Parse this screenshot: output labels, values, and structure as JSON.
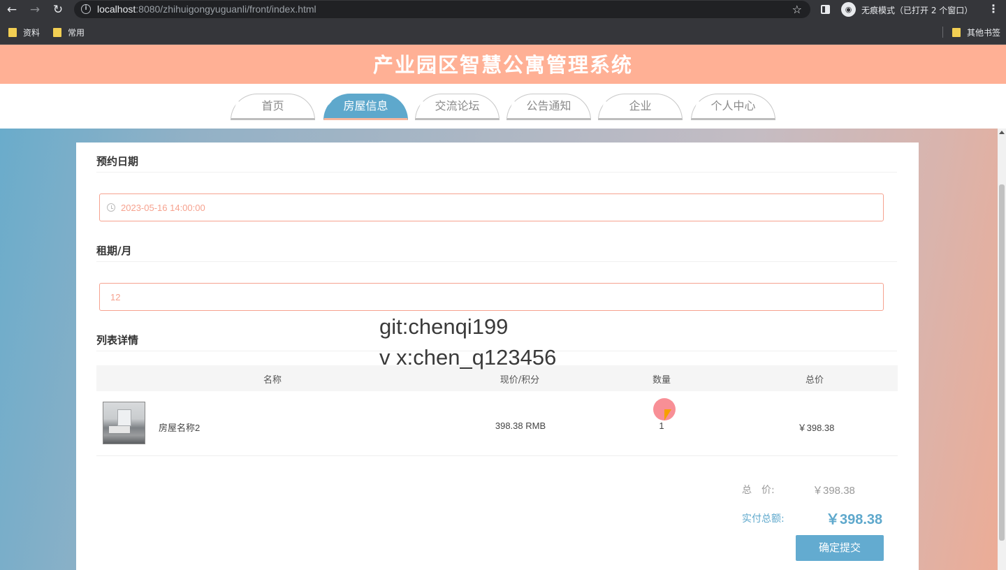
{
  "browser": {
    "url_host": "localhost",
    "url_rest": ":8080/zhihuigongyuguanli/front/index.html",
    "incognito_label": "无痕模式（已打开 2 个窗口）",
    "bookmarks": [
      "资料",
      "常用"
    ],
    "other_bookmarks": "其他书签"
  },
  "site": {
    "title": "产业园区智慧公寓管理系统",
    "nav": [
      {
        "label": "首页",
        "active": false
      },
      {
        "label": "房屋信息",
        "active": true
      },
      {
        "label": "交流论坛",
        "active": false
      },
      {
        "label": "公告通知",
        "active": false
      },
      {
        "label": "企业",
        "active": false
      },
      {
        "label": "个人中心",
        "active": false
      }
    ]
  },
  "form": {
    "date_label": "预约日期",
    "date_value": "2023-05-16 14:00:00",
    "term_label": "租期/月",
    "term_value": "12",
    "list_label": "列表详情"
  },
  "table": {
    "headers": [
      "名称",
      "现价/积分",
      "数量",
      "总价"
    ],
    "rows": [
      {
        "name": "房屋名称2",
        "price": "398.38 RMB",
        "qty": "1",
        "total": "￥398.38"
      }
    ]
  },
  "summary": {
    "total_label": "总　价:",
    "total_value": "￥398.38",
    "paid_label": "实付总额:",
    "paid_value": "￥398.38",
    "submit_label": "确定提交"
  },
  "watermark": {
    "line1": "git:chenqi199",
    "line2": "v x:chen_q123456"
  },
  "colors": {
    "header_bg": "#ffb095",
    "accent_blue": "#5ea8cc",
    "input_border": "#f6a28f"
  }
}
